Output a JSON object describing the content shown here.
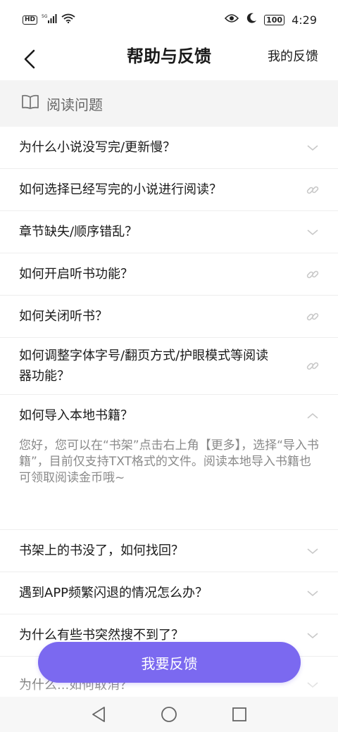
{
  "status_bar": {
    "left_badge": "HD",
    "signal_label": "5G",
    "battery": "100",
    "time": "4:29"
  },
  "nav": {
    "title": "帮助与反馈",
    "right_link": "我的反馈"
  },
  "section": {
    "title": "阅读问题",
    "icon": "book-icon"
  },
  "faq": [
    {
      "question": "为什么小说没写完/更新慢？",
      "icon": "chevron-down-icon"
    },
    {
      "question": "如何选择已经写完的小说进行阅读？",
      "icon": "link-icon"
    },
    {
      "question": "章节缺失/顺序错乱？",
      "icon": "chevron-down-icon"
    },
    {
      "question": "如何开启听书功能？",
      "icon": "link-icon"
    },
    {
      "question": "如何关闭听书？",
      "icon": "link-icon"
    },
    {
      "question": "如何调整字体字号/翻页方式/护眼模式等阅读器功能？",
      "icon": "link-icon"
    },
    {
      "question": "如何导入本地书籍？",
      "icon": "chevron-up-icon",
      "answer": "您好，您可以在“书架”点击右上角【更多】，选择“导入书籍”，目前仅支持TXT格式的文件。阅读本地导入书籍也可领取阅读金币哦~"
    },
    {
      "question": "书架上的书没了，如何找回？",
      "icon": "chevron-down-icon"
    },
    {
      "question": "遇到APP频繁闪退的情况怎么办？",
      "icon": "chevron-down-icon"
    },
    {
      "question": "为什么有些书突然搜不到了？",
      "icon": "chevron-down-icon"
    },
    {
      "question": "为什么...如何取消？",
      "icon": "chevron-down-icon"
    }
  ],
  "feedback_button": "我要反馈",
  "colors": {
    "accent": "#7b69f0",
    "icon_gray": "#c8c8c8",
    "section_bg": "#f4f4f4"
  }
}
